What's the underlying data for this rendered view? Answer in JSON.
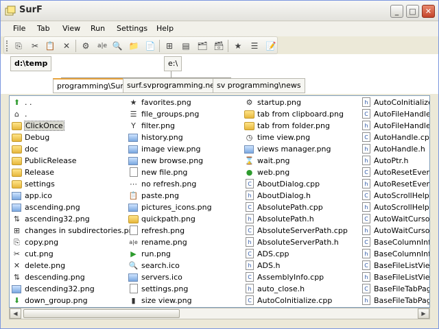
{
  "window": {
    "title": "SurF"
  },
  "menubar": {
    "items": [
      "File",
      "Tab",
      "View",
      "Run",
      "Settings",
      "Help"
    ]
  },
  "toolbar": {
    "buttons": [
      {
        "icon": "copy-icon",
        "glyph": "⎘"
      },
      {
        "icon": "cut-icon",
        "glyph": "✂"
      },
      {
        "icon": "paste-icon",
        "glyph": "📋"
      },
      {
        "icon": "delete-icon",
        "glyph": "✕"
      },
      {
        "icon": "properties-icon",
        "glyph": "⚙"
      },
      {
        "icon": "rename-icon",
        "glyph": "a|e"
      },
      {
        "icon": "search-icon",
        "glyph": "🔍"
      },
      {
        "icon": "new-folder-icon",
        "glyph": "📁"
      },
      {
        "icon": "new-file-icon",
        "glyph": "📄"
      },
      {
        "icon": "tree-icon",
        "glyph": "⊞"
      },
      {
        "icon": "tile-icon",
        "glyph": "▤"
      },
      {
        "icon": "tab-from-folder-icon",
        "glyph": "🗂"
      },
      {
        "icon": "tab-from-clipboard-icon",
        "glyph": "🗃"
      },
      {
        "icon": "favorites-icon",
        "glyph": "★"
      },
      {
        "icon": "history-icon",
        "glyph": "☰"
      },
      {
        "icon": "notes-icon",
        "glyph": "📝"
      }
    ]
  },
  "pathbar": {
    "drives": [
      "d:\\temp",
      "e:\\"
    ],
    "tabs": [
      "programming\\SurF",
      "surf.svprogramming.net",
      "sv programming\\news"
    ]
  },
  "files": {
    "columns": [
      [
        {
          "name": ". .",
          "icon": "up-icon",
          "kind": "sym-green",
          "glyph": "⬆"
        },
        {
          "name": ".",
          "icon": "home-icon",
          "kind": "sym",
          "glyph": "⌂"
        },
        {
          "name": "ClickOnce",
          "icon": "folder-icon",
          "kind": "folder",
          "selected": true
        },
        {
          "name": "Debug",
          "icon": "folder-icon",
          "kind": "folder"
        },
        {
          "name": "doc",
          "icon": "folder-icon",
          "kind": "folder"
        },
        {
          "name": "PublicRelease",
          "icon": "folder-icon",
          "kind": "folder"
        },
        {
          "name": "Release",
          "icon": "folder-icon",
          "kind": "folder"
        },
        {
          "name": "settings",
          "icon": "folder-icon",
          "kind": "folder"
        },
        {
          "name": "app.ico",
          "icon": "image-icon",
          "kind": "img"
        },
        {
          "name": "ascending.png",
          "icon": "image-icon",
          "kind": "img"
        },
        {
          "name": "ascending32.png",
          "icon": "sort-icon",
          "kind": "sym",
          "glyph": "⇅"
        },
        {
          "name": "changes in subdirectories.png",
          "icon": "tree-icon",
          "kind": "sym",
          "glyph": "⊞"
        },
        {
          "name": "copy.png",
          "icon": "copy-icon",
          "kind": "sym",
          "glyph": "⎘"
        },
        {
          "name": "cut.png",
          "icon": "cut-icon",
          "kind": "sym",
          "glyph": "✂"
        },
        {
          "name": "delete.png",
          "icon": "delete-icon",
          "kind": "sym",
          "glyph": "✕"
        },
        {
          "name": "descending.png",
          "icon": "sort-icon",
          "kind": "sym",
          "glyph": "⇅"
        },
        {
          "name": "descending32.png",
          "icon": "image-icon",
          "kind": "img"
        },
        {
          "name": "down_group.png",
          "icon": "down-arrow-icon",
          "kind": "sym-green",
          "glyph": "⬇"
        }
      ],
      [
        {
          "name": "favorites.png",
          "icon": "favorites-icon",
          "kind": "sym",
          "glyph": "★"
        },
        {
          "name": "file_groups.png",
          "icon": "file-groups-icon",
          "kind": "sym",
          "glyph": "☰"
        },
        {
          "name": "filter.png",
          "icon": "filter-icon",
          "kind": "sym",
          "glyph": "Y"
        },
        {
          "name": "history.png",
          "icon": "history-icon",
          "kind": "img"
        },
        {
          "name": "image view.png",
          "icon": "image-view-icon",
          "kind": "img"
        },
        {
          "name": "new browse.png",
          "icon": "browse-icon",
          "kind": "img"
        },
        {
          "name": "new file.png",
          "icon": "new-file-icon",
          "kind": "doc",
          "glyph": ""
        },
        {
          "name": "no refresh.png",
          "icon": "no-refresh-icon",
          "kind": "sym",
          "glyph": "⋯"
        },
        {
          "name": "paste.png",
          "icon": "paste-icon",
          "kind": "sym",
          "glyph": "📋"
        },
        {
          "name": "pictures_icons.png",
          "icon": "pictures-icon",
          "kind": "img"
        },
        {
          "name": "quickpath.png",
          "icon": "quickpath-icon",
          "kind": "folder"
        },
        {
          "name": "refresh.png",
          "icon": "refresh-icon",
          "kind": "doc",
          "glyph": ""
        },
        {
          "name": "rename.png",
          "icon": "rename-icon",
          "kind": "sym",
          "glyph": "a|e"
        },
        {
          "name": "run.png",
          "icon": "run-icon",
          "kind": "sym-green",
          "glyph": "▶"
        },
        {
          "name": "search.ico",
          "icon": "search-icon",
          "kind": "sym",
          "glyph": "🔍"
        },
        {
          "name": "servers.ico",
          "icon": "servers-icon",
          "kind": "img"
        },
        {
          "name": "settings.png",
          "icon": "settings-icon",
          "kind": "doc",
          "glyph": ""
        },
        {
          "name": "size view.png",
          "icon": "size-view-icon",
          "kind": "sym",
          "glyph": "▮"
        }
      ],
      [
        {
          "name": "startup.png",
          "icon": "startup-icon",
          "kind": "sym",
          "glyph": "⚙"
        },
        {
          "name": "tab from clipboard.png",
          "icon": "clipboard-icon",
          "kind": "folder"
        },
        {
          "name": "tab from folder.png",
          "icon": "folder-icon",
          "kind": "folder"
        },
        {
          "name": "time view.png",
          "icon": "clock-icon",
          "kind": "sym",
          "glyph": "◷"
        },
        {
          "name": "views manager.png",
          "icon": "views-icon",
          "kind": "img"
        },
        {
          "name": "wait.png",
          "icon": "hourglass-icon",
          "kind": "sym",
          "glyph": "⌛"
        },
        {
          "name": "web.png",
          "icon": "globe-icon",
          "kind": "sym-green",
          "glyph": "●"
        },
        {
          "name": "AboutDialog.cpp",
          "icon": "cpp-file-icon",
          "kind": "doc",
          "glyph": "C"
        },
        {
          "name": "AboutDialog.h",
          "icon": "h-file-icon",
          "kind": "doc",
          "glyph": "h"
        },
        {
          "name": "AbsolutePath.cpp",
          "icon": "cpp-file-icon",
          "kind": "doc",
          "glyph": "C"
        },
        {
          "name": "AbsolutePath.h",
          "icon": "h-file-icon",
          "kind": "doc",
          "glyph": "h"
        },
        {
          "name": "AbsoluteServerPath.cpp",
          "icon": "cpp-file-icon",
          "kind": "doc",
          "glyph": "C"
        },
        {
          "name": "AbsoluteServerPath.h",
          "icon": "h-file-icon",
          "kind": "doc",
          "glyph": "h"
        },
        {
          "name": "ADS.cpp",
          "icon": "cpp-file-icon",
          "kind": "doc",
          "glyph": "C"
        },
        {
          "name": "ADS.h",
          "icon": "h-file-icon",
          "kind": "doc",
          "glyph": "h"
        },
        {
          "name": "AssemblyInfo.cpp",
          "icon": "cpp-file-icon",
          "kind": "doc",
          "glyph": "C"
        },
        {
          "name": "auto_close.h",
          "icon": "h-file-icon",
          "kind": "doc",
          "glyph": "h"
        },
        {
          "name": "AutoColnitialize.cpp",
          "icon": "cpp-file-icon",
          "kind": "doc",
          "glyph": "C"
        }
      ],
      [
        {
          "name": "AutoColnitialize.h",
          "icon": "h-file-icon",
          "kind": "doc",
          "glyph": "h"
        },
        {
          "name": "AutoFileHandle.cp",
          "icon": "cpp-file-icon",
          "kind": "doc",
          "glyph": "C"
        },
        {
          "name": "AutoFileHandle.h",
          "icon": "h-file-icon",
          "kind": "doc",
          "glyph": "h"
        },
        {
          "name": "AutoHandle.cpp",
          "icon": "cpp-file-icon",
          "kind": "doc",
          "glyph": "C"
        },
        {
          "name": "AutoHandle.h",
          "icon": "h-file-icon",
          "kind": "doc",
          "glyph": "h"
        },
        {
          "name": "AutoPtr.h",
          "icon": "h-file-icon",
          "kind": "doc",
          "glyph": "h"
        },
        {
          "name": "AutoResetEvent.c",
          "icon": "cpp-file-icon",
          "kind": "doc",
          "glyph": "C"
        },
        {
          "name": "AutoResetEvent.h",
          "icon": "h-file-icon",
          "kind": "doc",
          "glyph": "h"
        },
        {
          "name": "AutoScrollHelper.",
          "icon": "cpp-file-icon",
          "kind": "doc",
          "glyph": "C"
        },
        {
          "name": "AutoScrollHelper.",
          "icon": "h-file-icon",
          "kind": "doc",
          "glyph": "h"
        },
        {
          "name": "AutoWaitCursor.c",
          "icon": "cpp-file-icon",
          "kind": "doc",
          "glyph": "C"
        },
        {
          "name": "AutoWaitCursor.h",
          "icon": "h-file-icon",
          "kind": "doc",
          "glyph": "h"
        },
        {
          "name": "BaseColumnInfo.c",
          "icon": "cpp-file-icon",
          "kind": "doc",
          "glyph": "C"
        },
        {
          "name": "BaseColumnInfo.h",
          "icon": "h-file-icon",
          "kind": "doc",
          "glyph": "h"
        },
        {
          "name": "BaseFileListView.",
          "icon": "cpp-file-icon",
          "kind": "doc",
          "glyph": "C"
        },
        {
          "name": "BaseFileListView.",
          "icon": "h-file-icon",
          "kind": "doc",
          "glyph": "h"
        },
        {
          "name": "BaseFileTabPage.",
          "icon": "cpp-file-icon",
          "kind": "doc",
          "glyph": "C"
        },
        {
          "name": "BaseFileTabPage.",
          "icon": "h-file-icon",
          "kind": "doc",
          "glyph": "h"
        }
      ]
    ]
  }
}
